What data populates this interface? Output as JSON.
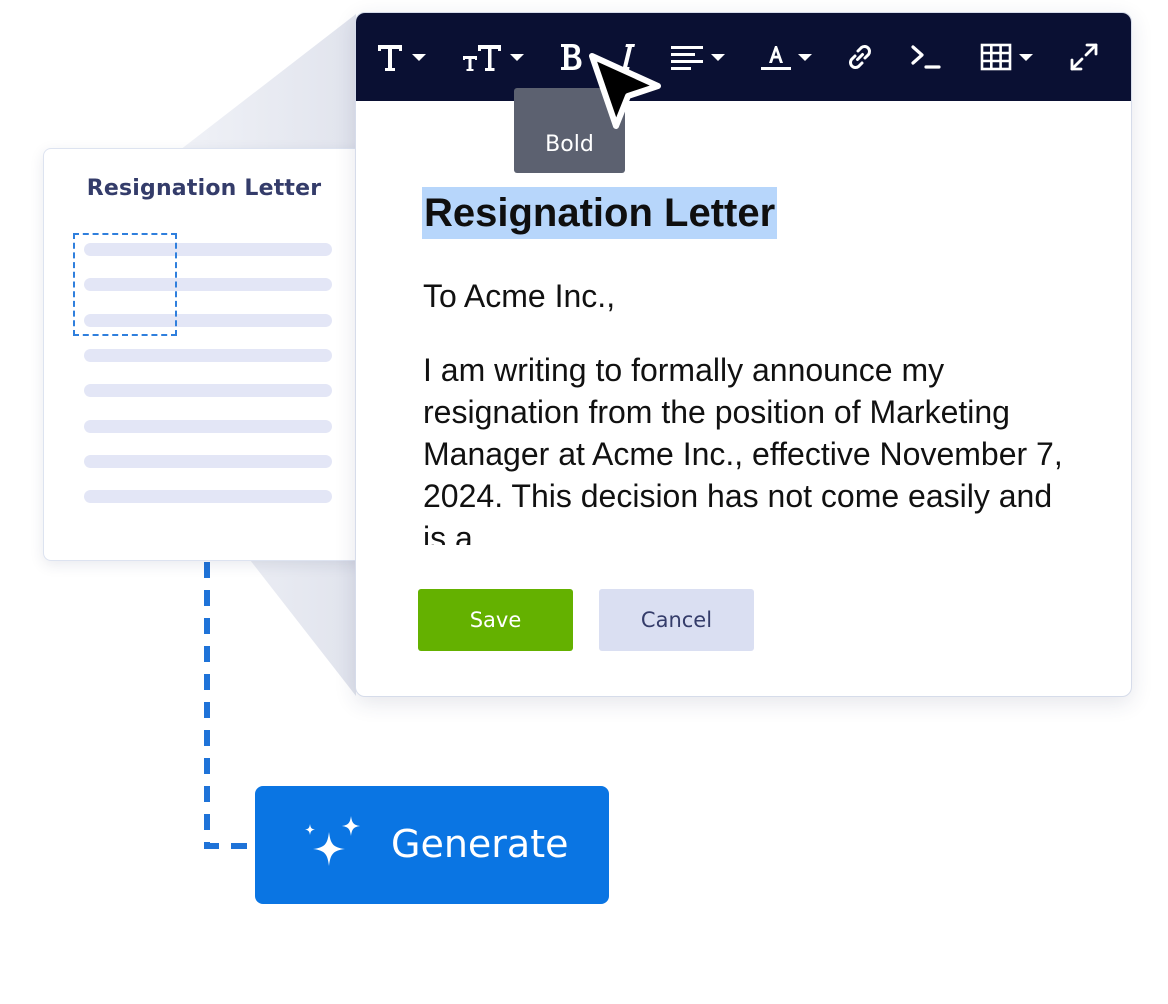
{
  "thumbnail": {
    "title": "Resignation Letter"
  },
  "editor": {
    "toolbar": {
      "tooltip": "Bold",
      "buttons": [
        {
          "name": "text-style-icon",
          "has_dropdown": true
        },
        {
          "name": "text-size-icon",
          "has_dropdown": true
        },
        {
          "name": "bold-icon",
          "has_dropdown": false
        },
        {
          "name": "italic-icon",
          "has_dropdown": false
        },
        {
          "name": "align-icon",
          "has_dropdown": true
        },
        {
          "name": "text-color-icon",
          "has_dropdown": true
        },
        {
          "name": "link-icon",
          "has_dropdown": false
        },
        {
          "name": "code-icon",
          "has_dropdown": false
        },
        {
          "name": "table-icon",
          "has_dropdown": true
        },
        {
          "name": "fullscreen-icon",
          "has_dropdown": false
        }
      ]
    },
    "document": {
      "heading": "Resignation Letter",
      "salutation": "To Acme Inc.,",
      "body": "I am writing to formally announce my resignation from the position of Marketing Manager at Acme Inc., effective November 7, 2024. This decision has not come easily and is a"
    },
    "save_label": "Save",
    "cancel_label": "Cancel"
  },
  "generate": {
    "label": "Generate"
  },
  "colors": {
    "toolbar_bg": "#0a1033",
    "save_bg": "#64b100",
    "cancel_bg": "#dadff2",
    "generate_bg": "#0a75e3",
    "selection_highlight": "#b7d6fb",
    "dashed_line": "#1f73d8"
  }
}
